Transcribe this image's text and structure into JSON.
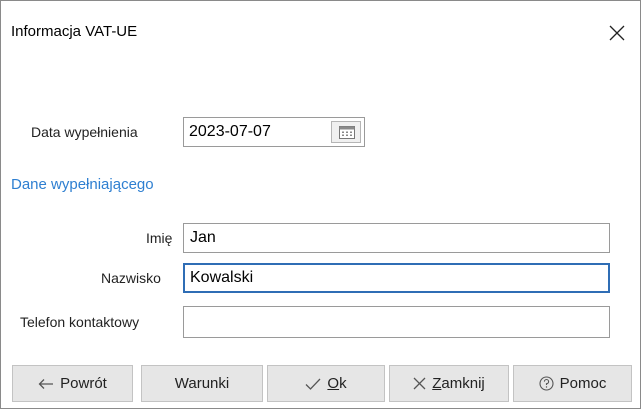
{
  "window": {
    "title": "Informacja VAT-UE",
    "close_icon": "close-icon"
  },
  "form": {
    "date": {
      "label": "Data wypełnienia",
      "value": "2023-07-07",
      "button_icon": "calendar-icon"
    },
    "section_title": "Dane wypełniającego",
    "first_name": {
      "label": "Imię",
      "value": "Jan"
    },
    "last_name": {
      "label": "Nazwisko",
      "value": "Kowalski"
    },
    "phone": {
      "label": "Telefon kontaktowy",
      "value": ""
    }
  },
  "buttons": {
    "back": {
      "label": "Powrót",
      "icon": "arrow-left-icon"
    },
    "conditions": {
      "label": "Warunki"
    },
    "ok": {
      "label": "Ok",
      "icon": "checkmark-icon"
    },
    "close": {
      "label": "Zamknij",
      "icon": "x-icon"
    },
    "help": {
      "label": "Pomoc",
      "icon": "question-circle-icon"
    }
  },
  "colors": {
    "link": "#2e7fd1",
    "focus_border": "#2f6db5",
    "button_bg": "#e6e6e6"
  }
}
